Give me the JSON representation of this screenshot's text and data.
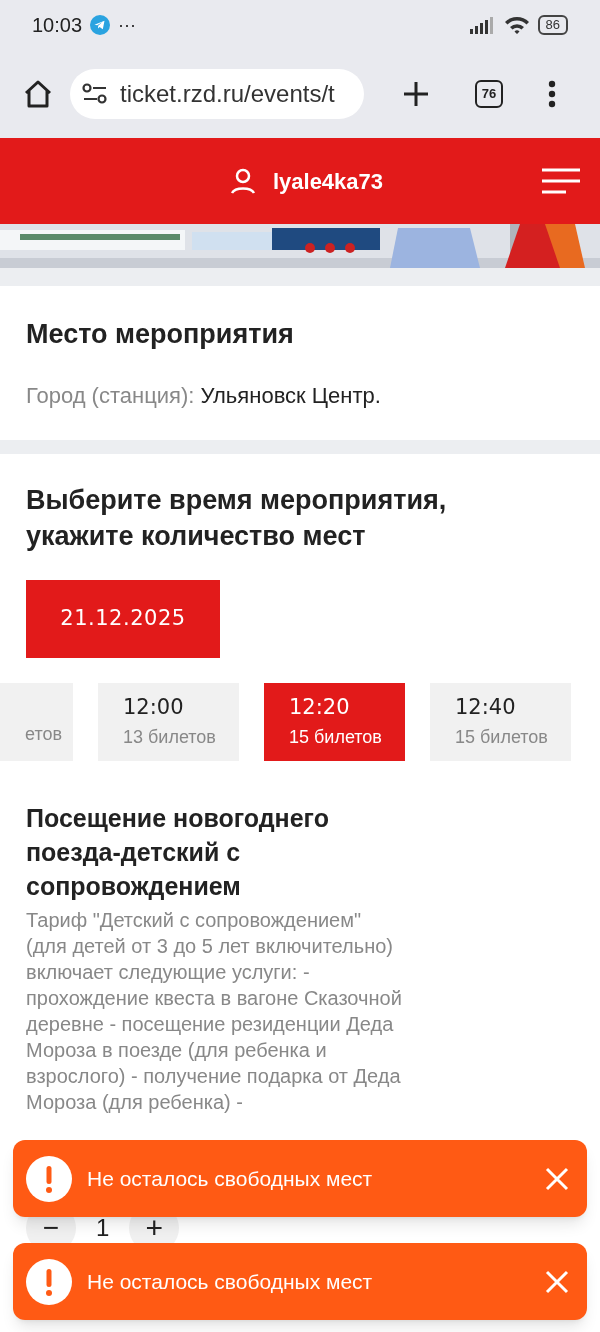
{
  "status_bar": {
    "time": "10:03",
    "more": "···",
    "battery": "86"
  },
  "browser": {
    "url": "ticket.rzd.ru/events/t",
    "tabs_count": "76"
  },
  "header": {
    "username": "lyale4ka73"
  },
  "venue": {
    "title": "Место мероприятия",
    "label": "Город (станция):",
    "value": "Ульяновск Центр."
  },
  "schedule": {
    "title": "Выберите время мероприятия, укажите количество мест",
    "dates": [
      {
        "label": "21.12.2025",
        "selected": true
      }
    ],
    "slots": [
      {
        "tickets": "етов",
        "selected": false
      },
      {
        "time": "12:00",
        "tickets": "13 билетов",
        "selected": false
      },
      {
        "time": "12:20",
        "tickets": "15 билетов",
        "selected": true
      },
      {
        "time": "12:40",
        "tickets": "15 билетов",
        "selected": false
      }
    ]
  },
  "tariff": {
    "title": "Посещение новогоднего поезда-детский с сопровождением",
    "description": "Тариф \"Детский с сопровождением\" (для детей от 3 до 5 лет включительно) включает следующие услуги: - прохождение квеста в вагоне Сказочной деревне - посещение резиденции Деда Мороза в поезде (для ребенка и взрослого) - получение подарка от Деда Мороза (для ребенка) -",
    "minus": "−",
    "quantity": "1",
    "plus": "+"
  },
  "toasts": [
    {
      "message": "Не осталось свободных мест"
    },
    {
      "message": "Не осталось свободных мест"
    }
  ]
}
